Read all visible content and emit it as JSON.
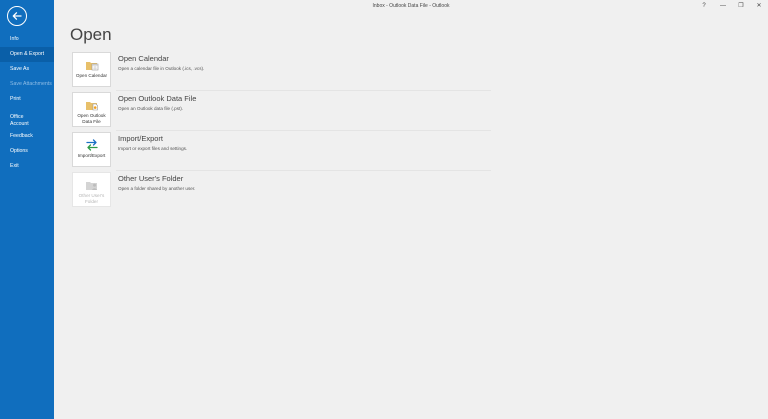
{
  "window": {
    "title": "Inbox - Outlook Data File  -  Outlook",
    "help": "?",
    "minimize": "—",
    "restore": "❐",
    "close": "✕"
  },
  "sidebar": {
    "items": [
      {
        "label": "Info",
        "state": "normal"
      },
      {
        "label": "Open & Export",
        "state": "selected"
      },
      {
        "label": "Save As",
        "state": "normal"
      },
      {
        "label": "Save Attachments",
        "state": "disabled"
      },
      {
        "label": "Print",
        "state": "normal"
      },
      {
        "label": "Office Account",
        "state": "normal"
      },
      {
        "label": "Feedback",
        "state": "normal"
      },
      {
        "label": "Options",
        "state": "normal"
      },
      {
        "label": "Exit",
        "state": "normal"
      }
    ]
  },
  "main": {
    "title": "Open",
    "options": [
      {
        "tile_label": "Open Calendar",
        "title": "Open Calendar",
        "description": "Open a calendar file in Outlook (.ics, .vcs).",
        "icon": "calendar-folder-icon",
        "enabled": true
      },
      {
        "tile_label": "Open Outlook Data File",
        "title": "Open Outlook Data File",
        "description": "Open an Outlook data file (.pst).",
        "icon": "data-file-folder-icon",
        "enabled": true
      },
      {
        "tile_label": "Import/Export",
        "title": "Import/Export",
        "description": "Import or export files and settings.",
        "icon": "import-export-arrows-icon",
        "enabled": true
      },
      {
        "tile_label": "Other User's Folder",
        "title": "Other User's Folder",
        "description": "Open a folder shared by another user.",
        "icon": "shared-folder-icon",
        "enabled": false
      }
    ]
  },
  "colors": {
    "sidebar": "#106ebe",
    "sidebar_selected": "#0a5fa8",
    "background": "#f0f0f0",
    "icon_folder": "#e8c06a",
    "icon_arrows_green": "#2e9b47",
    "icon_arrows_blue": "#1a6fc4"
  }
}
